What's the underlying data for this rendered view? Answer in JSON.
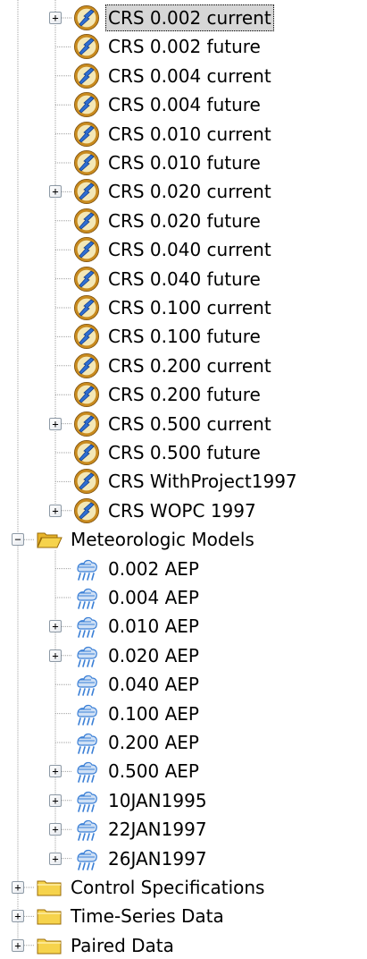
{
  "colors": {
    "tree_line": "#a0a0a0",
    "selection_bg": "#d6d6d6",
    "folder_fill": "#f6d34c",
    "basin_ring": "#c88a1e",
    "basin_center": "#f3e7b6",
    "basin_bolt": "#2f6fd4",
    "storm_blue": "#3a7fd6"
  },
  "tree": {
    "basin_models": [
      {
        "label": "CRS 0.002 current",
        "icon": "basin-model-icon",
        "expandable": true,
        "expanded": false,
        "selected": true
      },
      {
        "label": "CRS 0.002 future",
        "icon": "basin-model-icon",
        "expandable": false
      },
      {
        "label": "CRS 0.004 current",
        "icon": "basin-model-icon",
        "expandable": false
      },
      {
        "label": "CRS 0.004 future",
        "icon": "basin-model-icon",
        "expandable": false
      },
      {
        "label": "CRS 0.010 current",
        "icon": "basin-model-icon",
        "expandable": false
      },
      {
        "label": "CRS 0.010 future",
        "icon": "basin-model-icon",
        "expandable": false
      },
      {
        "label": "CRS 0.020 current",
        "icon": "basin-model-icon",
        "expandable": true,
        "expanded": false
      },
      {
        "label": "CRS 0.020 future",
        "icon": "basin-model-icon",
        "expandable": false
      },
      {
        "label": "CRS 0.040 current",
        "icon": "basin-model-icon",
        "expandable": false
      },
      {
        "label": "CRS 0.040 future",
        "icon": "basin-model-icon",
        "expandable": false
      },
      {
        "label": "CRS 0.100 current",
        "icon": "basin-model-icon",
        "expandable": false
      },
      {
        "label": "CRS 0.100 future",
        "icon": "basin-model-icon",
        "expandable": false
      },
      {
        "label": "CRS 0.200 current",
        "icon": "basin-model-icon",
        "expandable": false
      },
      {
        "label": "CRS 0.200 future",
        "icon": "basin-model-icon",
        "expandable": false
      },
      {
        "label": "CRS 0.500 current",
        "icon": "basin-model-icon",
        "expandable": true,
        "expanded": false
      },
      {
        "label": "CRS 0.500 future",
        "icon": "basin-model-icon",
        "expandable": false
      },
      {
        "label": "CRS WithProject1997",
        "icon": "basin-model-icon",
        "expandable": false
      },
      {
        "label": "CRS WOPC 1997",
        "icon": "basin-model-icon",
        "expandable": true,
        "expanded": false
      }
    ],
    "meteorologic_folder": {
      "label": "Meteorologic Models",
      "icon": "folder-open-icon",
      "expandable": true,
      "expanded": true
    },
    "meteorologic_models": [
      {
        "label": "0.002 AEP",
        "icon": "meteorologic-model-icon",
        "expandable": false
      },
      {
        "label": "0.004 AEP",
        "icon": "meteorologic-model-icon",
        "expandable": false
      },
      {
        "label": "0.010 AEP",
        "icon": "meteorologic-model-icon",
        "expandable": true,
        "expanded": false
      },
      {
        "label": "0.020 AEP",
        "icon": "meteorologic-model-icon",
        "expandable": true,
        "expanded": false
      },
      {
        "label": "0.040 AEP",
        "icon": "meteorologic-model-icon",
        "expandable": false
      },
      {
        "label": "0.100 AEP",
        "icon": "meteorologic-model-icon",
        "expandable": false
      },
      {
        "label": "0.200 AEP",
        "icon": "meteorologic-model-icon",
        "expandable": false
      },
      {
        "label": "0.500 AEP",
        "icon": "meteorologic-model-icon",
        "expandable": true,
        "expanded": false
      },
      {
        "label": "10JAN1995",
        "icon": "meteorologic-model-icon",
        "expandable": true,
        "expanded": false
      },
      {
        "label": "22JAN1997",
        "icon": "meteorologic-model-icon",
        "expandable": true,
        "expanded": false
      },
      {
        "label": "26JAN1997",
        "icon": "meteorologic-model-icon",
        "expandable": true,
        "expanded": false
      }
    ],
    "root_folders": [
      {
        "label": "Control Specifications",
        "icon": "folder-closed-icon",
        "expandable": true,
        "expanded": false
      },
      {
        "label": "Time-Series Data",
        "icon": "folder-closed-icon",
        "expandable": true,
        "expanded": false
      },
      {
        "label": "Paired Data",
        "icon": "folder-closed-icon",
        "expandable": true,
        "expanded": false
      }
    ]
  }
}
